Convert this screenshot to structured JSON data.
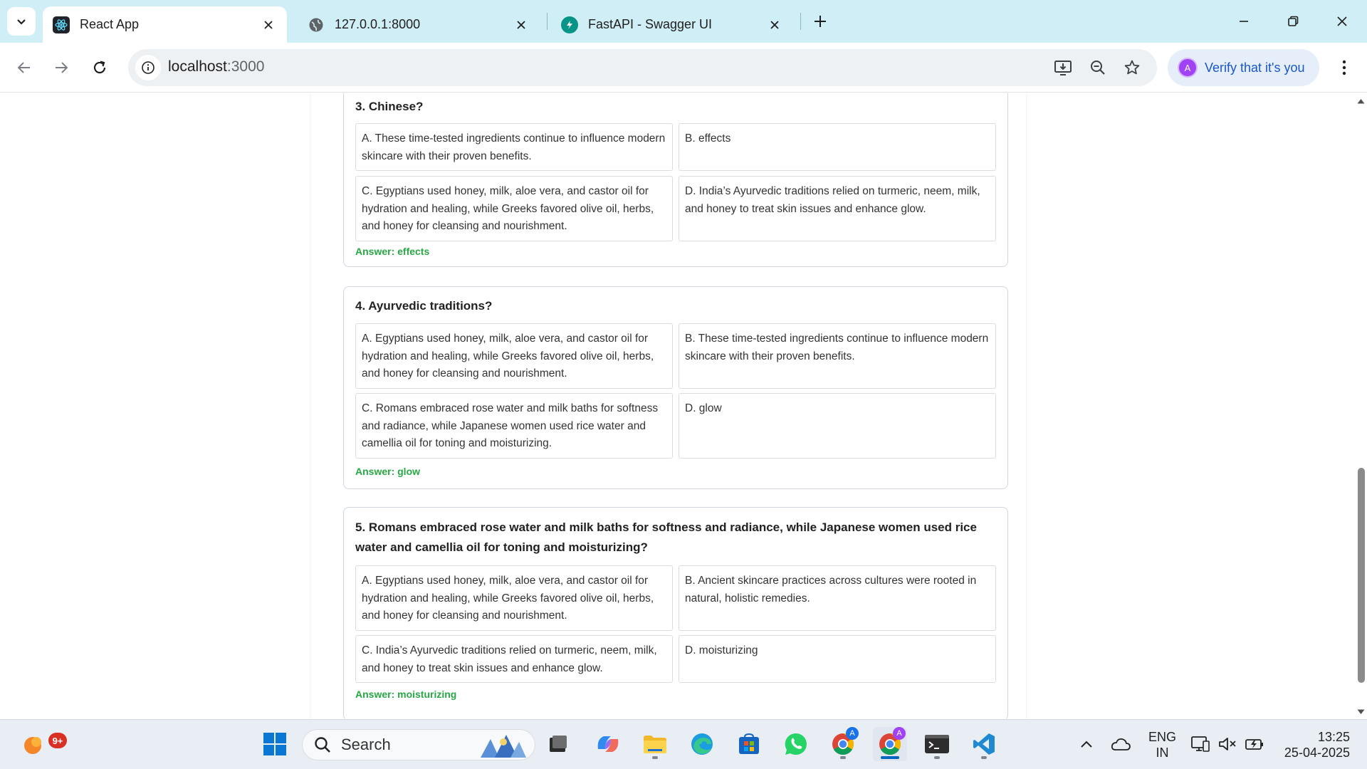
{
  "browser": {
    "tabs": [
      {
        "title": "React App",
        "favicon": "react-icon"
      },
      {
        "title": "127.0.0.1:8000",
        "favicon": "globe-icon"
      },
      {
        "title": "FastAPI - Swagger UI",
        "favicon": "fastapi-icon"
      }
    ],
    "address": {
      "host": "localhost",
      "port": ":3000"
    },
    "verify_label": "Verify that it's you",
    "profile_initial": "A"
  },
  "questions": [
    {
      "title": "3. Chinese?",
      "options": [
        "A. These time-tested ingredients continue to influence modern skincare with their proven benefits.",
        "B. effects",
        "C. Egyptians used honey, milk, aloe vera, and castor oil for hydration and healing, while Greeks favored olive oil, herbs, and honey for cleansing and nourishment.",
        "D. India’s Ayurvedic traditions relied on turmeric, neem, milk, and honey to treat skin issues and enhance glow."
      ],
      "answer": "Answer: effects"
    },
    {
      "title": "4. Ayurvedic traditions?",
      "options": [
        "A. Egyptians used honey, milk, aloe vera, and castor oil for hydration and healing, while Greeks favored olive oil, herbs, and honey for cleansing and nourishment.",
        "B. These time-tested ingredients continue to influence modern skincare with their proven benefits.",
        "C. Romans embraced rose water and milk baths for softness and radiance, while Japanese women used rice water and camellia oil for toning and moisturizing.",
        "D. glow"
      ],
      "answer": "Answer: glow"
    },
    {
      "title": "5. Romans embraced rose water and milk baths for softness and radiance, while Japanese women used rice water and camellia oil for toning and moisturizing?",
      "options": [
        "A. Egyptians used honey, milk, aloe vera, and castor oil for hydration and healing, while Greeks favored olive oil, herbs, and honey for cleansing and nourishment.",
        "B. Ancient skincare practices across cultures were rooted in natural, holistic remedies.",
        "C. India’s Ayurvedic traditions relied on turmeric, neem, milk, and honey to treat skin issues and enhance glow.",
        "D. moisturizing"
      ],
      "answer": "Answer: moisturizing"
    }
  ],
  "taskbar": {
    "notification_badge": "9+",
    "search_label": "Search",
    "language": {
      "line1": "ENG",
      "line2": "IN"
    },
    "time": "13:25",
    "date": "25-04-2025",
    "chrome_profile_initial": "A"
  },
  "colors": {
    "tabstrip": "#cfeef5",
    "answer_green": "#28a745",
    "link_blue": "#1a56c8",
    "taskbar": "#e9eef5"
  }
}
